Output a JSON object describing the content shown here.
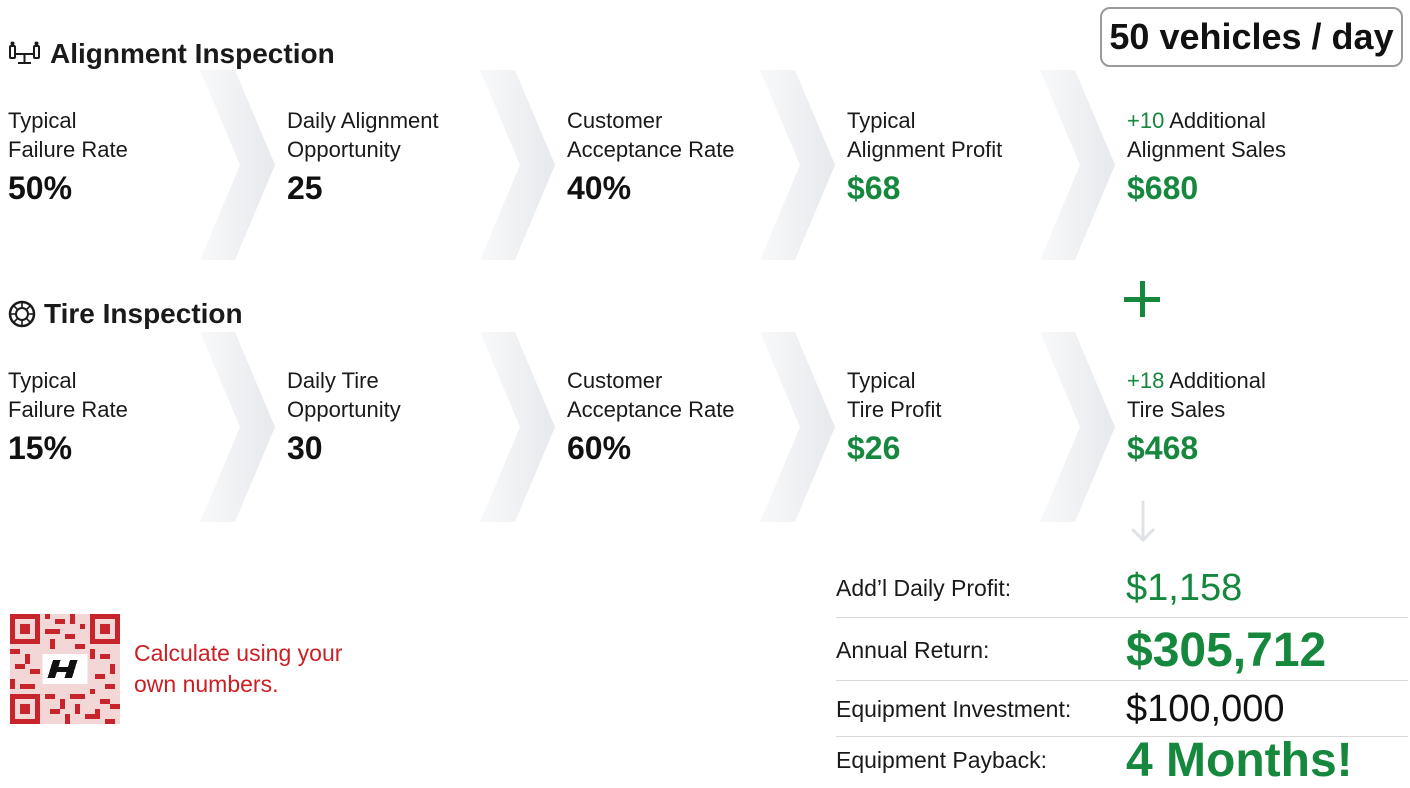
{
  "header": {
    "volume": "50 vehicles / day"
  },
  "alignment": {
    "title": "Alignment Inspection",
    "steps": [
      {
        "label_l1": "Typical",
        "label_l2": "Failure Rate",
        "value": "50%"
      },
      {
        "label_l1": "Daily Alignment",
        "label_l2": "Opportunity",
        "value": "25"
      },
      {
        "label_l1": "Customer",
        "label_l2": "Acceptance Rate",
        "value": "40%"
      },
      {
        "label_l1": "Typical",
        "label_l2": "Alignment Profit",
        "value": "$68"
      },
      {
        "prefix": "+10",
        "label_l1": " Additional",
        "label_l2": "Alignment Sales",
        "value": "$680"
      }
    ]
  },
  "tire": {
    "title": "Tire Inspection",
    "steps": [
      {
        "label_l1": "Typical",
        "label_l2": "Failure Rate",
        "value": "15%"
      },
      {
        "label_l1": "Daily Tire",
        "label_l2": "Opportunity",
        "value": "30"
      },
      {
        "label_l1": "Customer",
        "label_l2": "Acceptance Rate",
        "value": "60%"
      },
      {
        "label_l1": "Typical",
        "label_l2": "Tire Profit",
        "value": "$26"
      },
      {
        "prefix": "+18",
        "label_l1": " Additional",
        "label_l2": "Tire Sales",
        "value": "$468"
      }
    ]
  },
  "summary": {
    "daily_profit_label": "Add’l Daily Profit:",
    "daily_profit_value": "$1,158",
    "annual_return_label": "Annual Return:",
    "annual_return_value": "$305,712",
    "investment_label": "Equipment Investment:",
    "investment_value": "$100,000",
    "payback_label": "Equipment Payback:",
    "payback_value": "4 Months!"
  },
  "cta": {
    "line1": "Calculate using your",
    "line2": "own numbers."
  },
  "icons": {
    "alignment": "alignment-icon",
    "tire": "tire-icon",
    "qr": "qr-code-icon",
    "plus": "plus-icon",
    "arrow": "arrow-down-icon"
  },
  "colors": {
    "green": "#15883e",
    "red": "#cc1f24",
    "chevron": "#eef0f3"
  }
}
